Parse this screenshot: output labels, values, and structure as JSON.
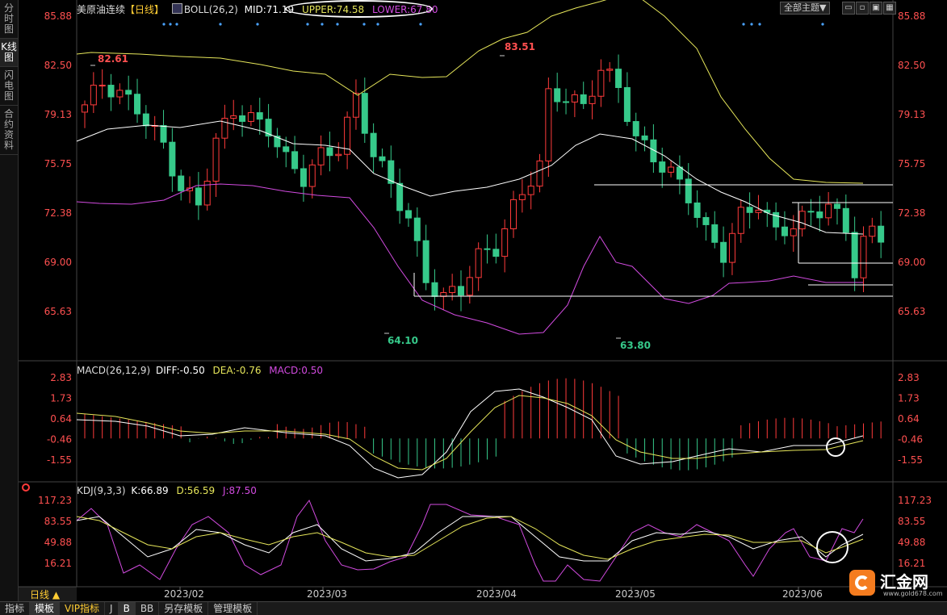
{
  "sidebar": {
    "items": [
      {
        "label": "分时图",
        "active": false
      },
      {
        "label": "K线图",
        "active": true
      },
      {
        "label": "闪电图",
        "active": false
      },
      {
        "label": "合约资料",
        "active": false
      }
    ]
  },
  "main": {
    "instrument": "美原油连续",
    "period": "【日线】",
    "indicator": "BOLL(26,2)",
    "mid": "MID:71.19",
    "upper": "UPPER:74.58",
    "lower": "LOWER:67.80",
    "theme_select": "全部主题▼",
    "y_ticks": [
      "85.88",
      "82.50",
      "79.13",
      "75.75",
      "72.38",
      "69.00",
      "65.63"
    ],
    "annotations": {
      "high1": "82.61",
      "high2": "83.51",
      "low1": "64.10",
      "low2": "63.80"
    }
  },
  "macd": {
    "title": "MACD(26,12,9)",
    "diff": "DIFF:-0.50",
    "dea": "DEA:-0.76",
    "macd": "MACD:0.50",
    "y_ticks": [
      "2.83",
      "1.73",
      "0.64",
      "-0.46",
      "-1.55"
    ]
  },
  "kdj": {
    "title": "KDJ(9,3,3)",
    "k": "K:66.89",
    "d": "D:56.59",
    "j": "J:87.50",
    "y_ticks": [
      "117.23",
      "83.55",
      "49.88",
      "16.21"
    ]
  },
  "x_axis": {
    "period_label": "日线 ▲",
    "months": [
      "2023/02",
      "2023/03",
      "2023/04",
      "2023/05",
      "2023/06"
    ]
  },
  "bottom_tabs": [
    "指标",
    "模板",
    "VIP指标",
    "J",
    "B",
    "BB",
    "另存模板",
    "管理模板"
  ],
  "logo": {
    "name": "汇金网",
    "url": "www.gold678.com"
  },
  "colors": {
    "up": "#ff3b3b",
    "down": "#36c98a",
    "mid": "#ffffff",
    "upper": "#e6e65a",
    "lower": "#d24be0",
    "axis_text": "#ff5050"
  }
}
